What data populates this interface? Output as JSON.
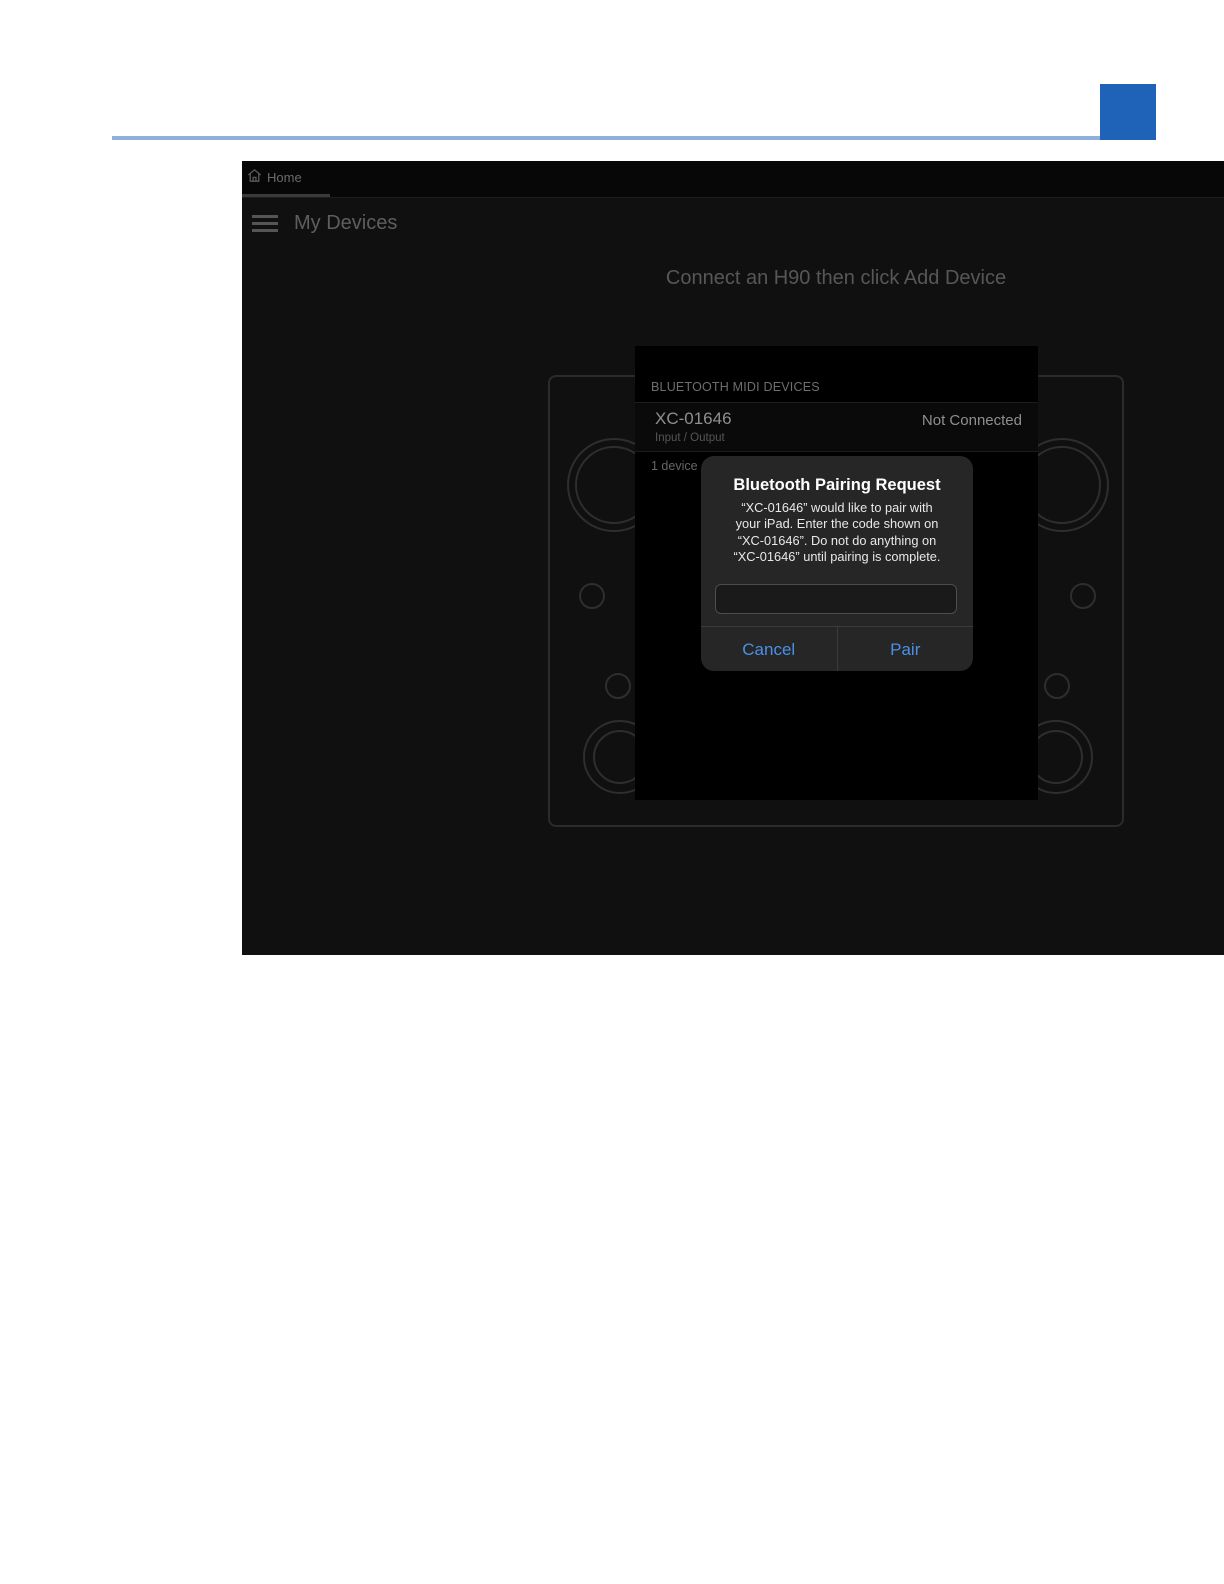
{
  "tabs": [
    {
      "label": "Home",
      "icon": "home-icon"
    }
  ],
  "app_bar": {
    "menu_icon": "hamburger-menu-icon",
    "title": "My Devices"
  },
  "main": {
    "instruction": "Connect an H90 then click Add Device"
  },
  "bluetooth_panel": {
    "header": "BLUETOOTH MIDI DEVICES",
    "devices": [
      {
        "name": "XC-01646",
        "type": "Input / Output",
        "status": "Not Connected"
      }
    ],
    "device_count": "1 device"
  },
  "pairing_dialog": {
    "title": "Bluetooth Pairing Request",
    "message_lines": [
      "“XC-01646” would like to pair with",
      "your iPad. Enter the code shown on",
      "“XC-01646”. Do not do anything on",
      "“XC-01646” until pairing is complete."
    ],
    "code_value": "",
    "cancel_label": "Cancel",
    "pair_label": "Pair",
    "button_color": "#4a8fe7"
  },
  "colors": {
    "page_rule": "#8fb0dd",
    "page_tab": "#1f63b8",
    "app_background": "#101010"
  }
}
